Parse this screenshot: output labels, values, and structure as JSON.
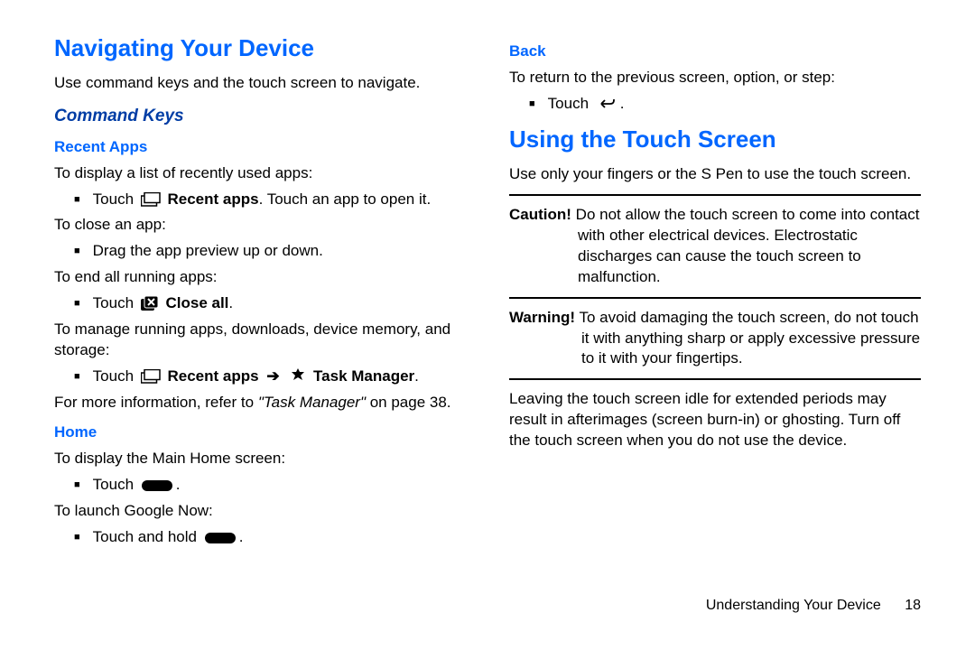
{
  "left": {
    "h1": "Navigating Your Device",
    "intro": "Use command keys and the touch screen to navigate.",
    "h2": "Command Keys",
    "recentApps": {
      "h3": "Recent Apps",
      "p1": "To display a list of recently used apps:",
      "b1_pre": "Touch ",
      "b1_bold": "Recent apps",
      "b1_post": ". Touch an app to open it.",
      "p2": "To close an app:",
      "b2": "Drag the app preview up or down.",
      "p3": "To end all running apps:",
      "b3_pre": "Touch ",
      "b3_bold": "Close all",
      "b3_post": ".",
      "p4": "To manage running apps, downloads, device memory, and storage:",
      "b4_pre": "Touch ",
      "b4_boldA": "Recent apps",
      "b4_arrow": "➔",
      "b4_boldB": "Task Manager",
      "b4_post": ".",
      "p5_pre": "For more information, refer to ",
      "p5_ital": "\"Task Manager\"",
      "p5_post": " on page 38."
    },
    "home": {
      "h3": "Home",
      "p1": "To display the Main Home screen:",
      "b1_pre": "Touch ",
      "b1_post": ".",
      "p2": "To launch Google Now:",
      "b2_pre": "Touch and hold ",
      "b2_post": "."
    }
  },
  "right": {
    "back": {
      "h3": "Back",
      "p1": "To return to the previous screen, option, or step:",
      "b1_pre": "Touch ",
      "b1_post": "."
    },
    "h1": "Using the Touch Screen",
    "intro": "Use only your fingers or the S Pen to use the touch screen.",
    "caution_label": "Caution!",
    "caution_text": " Do not allow the touch screen to come into contact with other electrical devices. Electrostatic discharges can cause the touch screen to malfunction.",
    "warning_label": "Warning!",
    "warning_text": " To avoid damaging the touch screen, do not touch it with anything sharp or apply excessive pressure to it with your fingertips.",
    "idle": "Leaving the touch screen idle for extended periods may result in afterimages (screen burn-in) or ghosting. Turn off the touch screen when you do not use the device."
  },
  "footer": {
    "chapter": "Understanding Your Device",
    "page": "18"
  }
}
